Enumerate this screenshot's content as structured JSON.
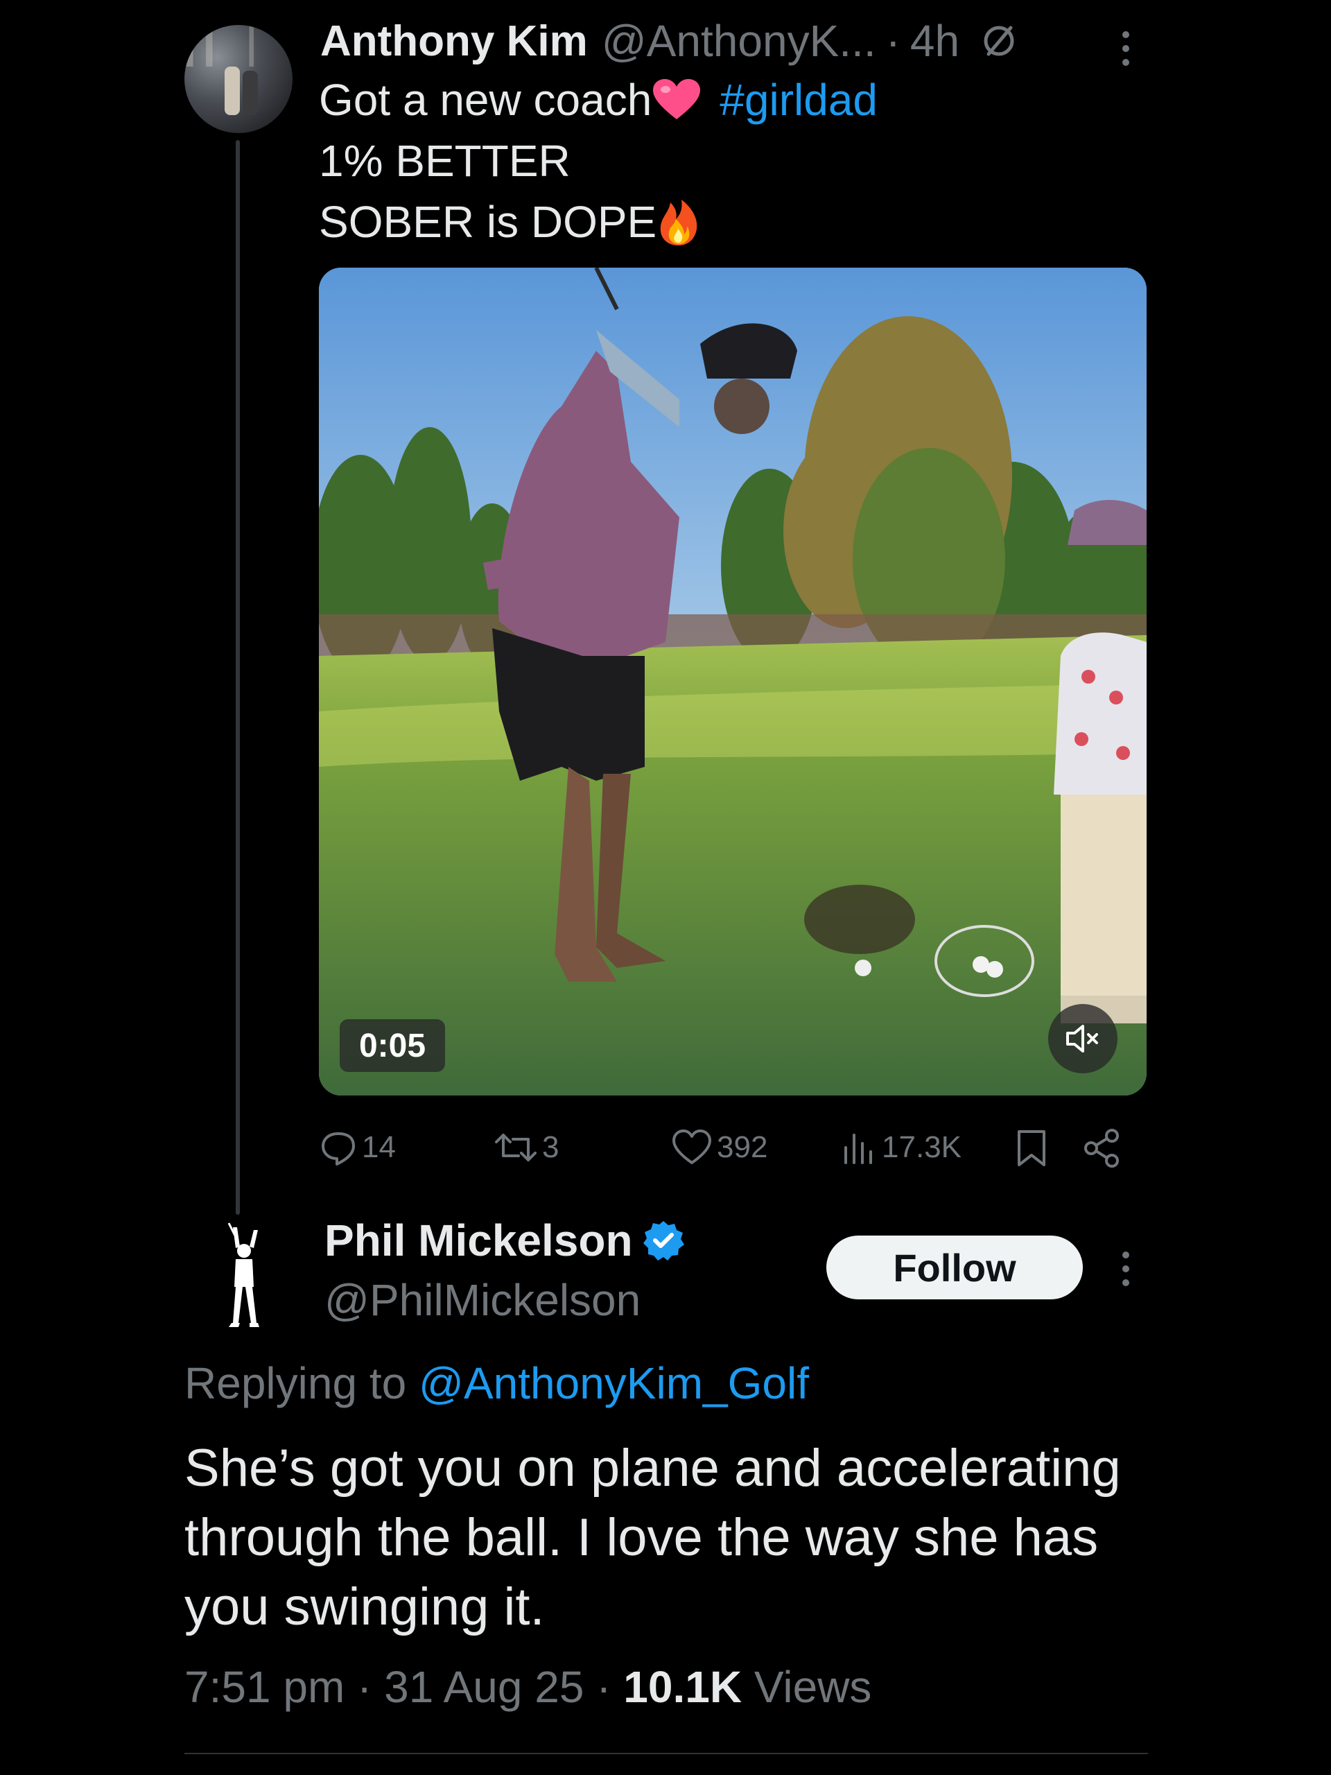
{
  "parent_tweet": {
    "author_name": "Anthony Kim",
    "handle": "@AnthonyK...",
    "separator": "·",
    "time": "4h",
    "lines": {
      "line1_text": "Got a new coach",
      "line1_hashtag": "#girldad",
      "line2": "1% BETTER",
      "line3": "SOBER is DOPE"
    },
    "video": {
      "duration": "0:05"
    },
    "actions": {
      "replies": "14",
      "reposts": "3",
      "likes": "392",
      "views": "17.3K"
    }
  },
  "reply_tweet": {
    "author_name": "Phil Mickelson",
    "handle": "@PhilMickelson",
    "follow_label": "Follow",
    "replying_prefix": "Replying to",
    "replying_handle": "@AnthonyKim_Golf",
    "text": "She’s got you on plane and accelerating through the ball. I love the way she has you swinging it.",
    "time": "7:51 pm",
    "separator": "·",
    "date": "31 Aug 25",
    "views_count": "10.1K",
    "views_label": "Views"
  },
  "colors": {
    "background": "#000000",
    "text": "#e7e9ea",
    "muted": "#71767b",
    "link": "#1d9bf0",
    "verified": "#1d9bf0"
  }
}
